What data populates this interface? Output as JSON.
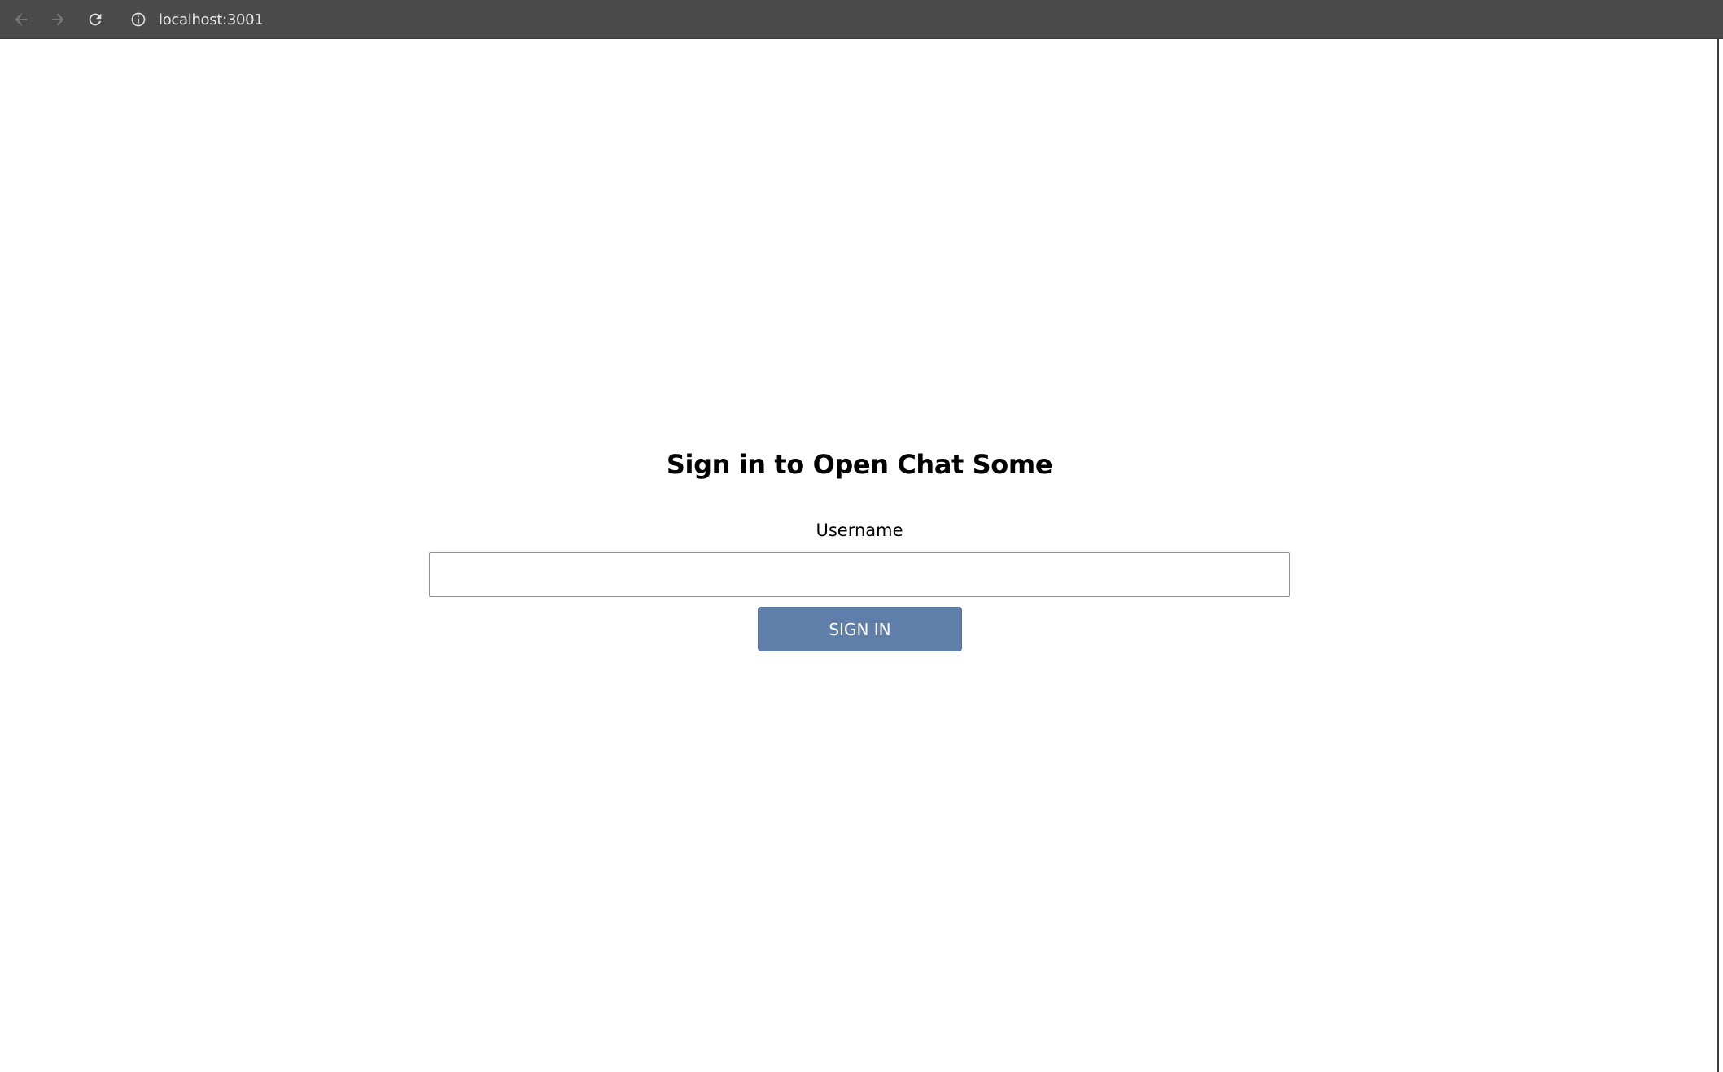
{
  "browser": {
    "url": "localhost:3001",
    "icons": {
      "back": "arrow-left-icon",
      "forward": "arrow-right-icon",
      "reload": "reload-icon",
      "site_info": "info-icon"
    }
  },
  "signin": {
    "title": "Sign in to Open Chat Some",
    "username_label": "Username",
    "username_value": "",
    "button_label": "SIGN IN",
    "button_color": "#5f7eaa"
  }
}
